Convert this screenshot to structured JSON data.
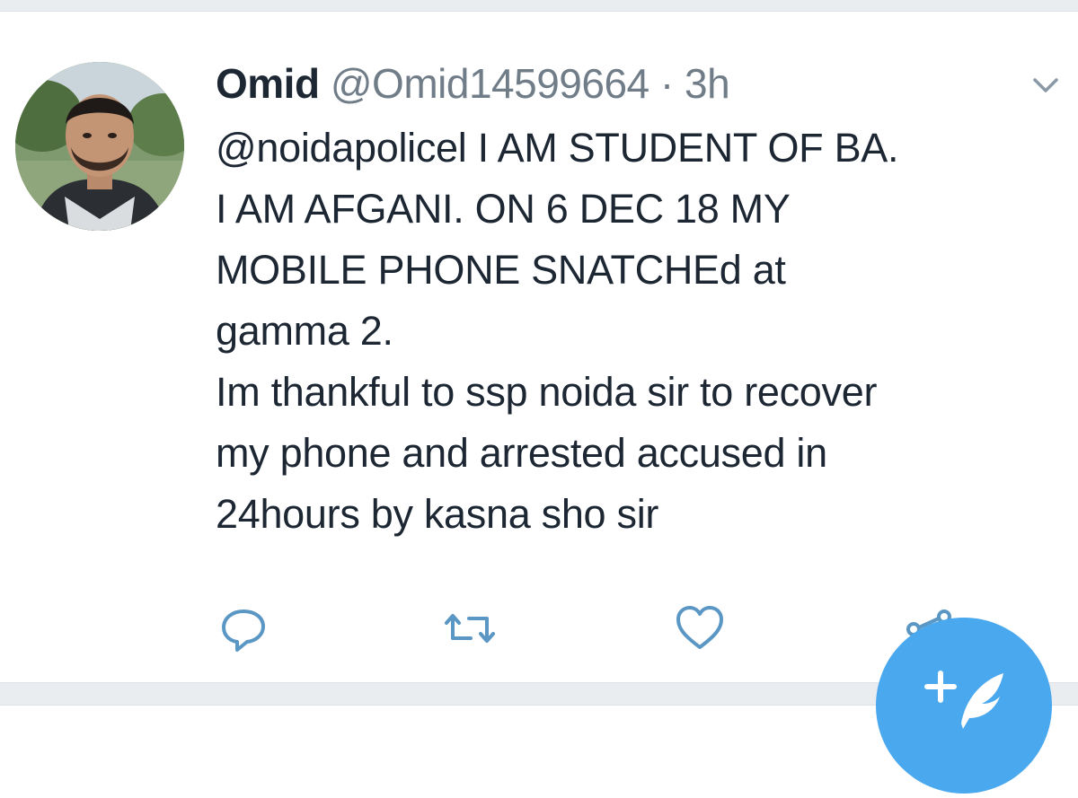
{
  "tweet": {
    "name": "Omid",
    "handle": "@Omid14599664",
    "separator": "·",
    "time": "3h",
    "text_lines": [
      "@noidapolicel I AM STUDENT OF BA.",
      "I AM AFGANI. ON 6 DEC 18 MY",
      "MOBILE PHONE SNATCHEd at",
      "gamma 2.",
      "Im thankful to ssp noida sir to recover",
      "my phone and arrested accused in",
      "24hours by kasna sho sir"
    ]
  },
  "icons": {
    "caret": "chevron-down-icon",
    "reply": "reply-icon",
    "retweet": "retweet-icon",
    "like": "heart-icon",
    "share": "share-icon",
    "compose": "compose-tweet-icon"
  },
  "colors": {
    "accent": "#4aa8ee",
    "icon": "#5b97c4",
    "muted_text": "#707d88",
    "text": "#1c2733",
    "divider": "#e9edf0"
  }
}
